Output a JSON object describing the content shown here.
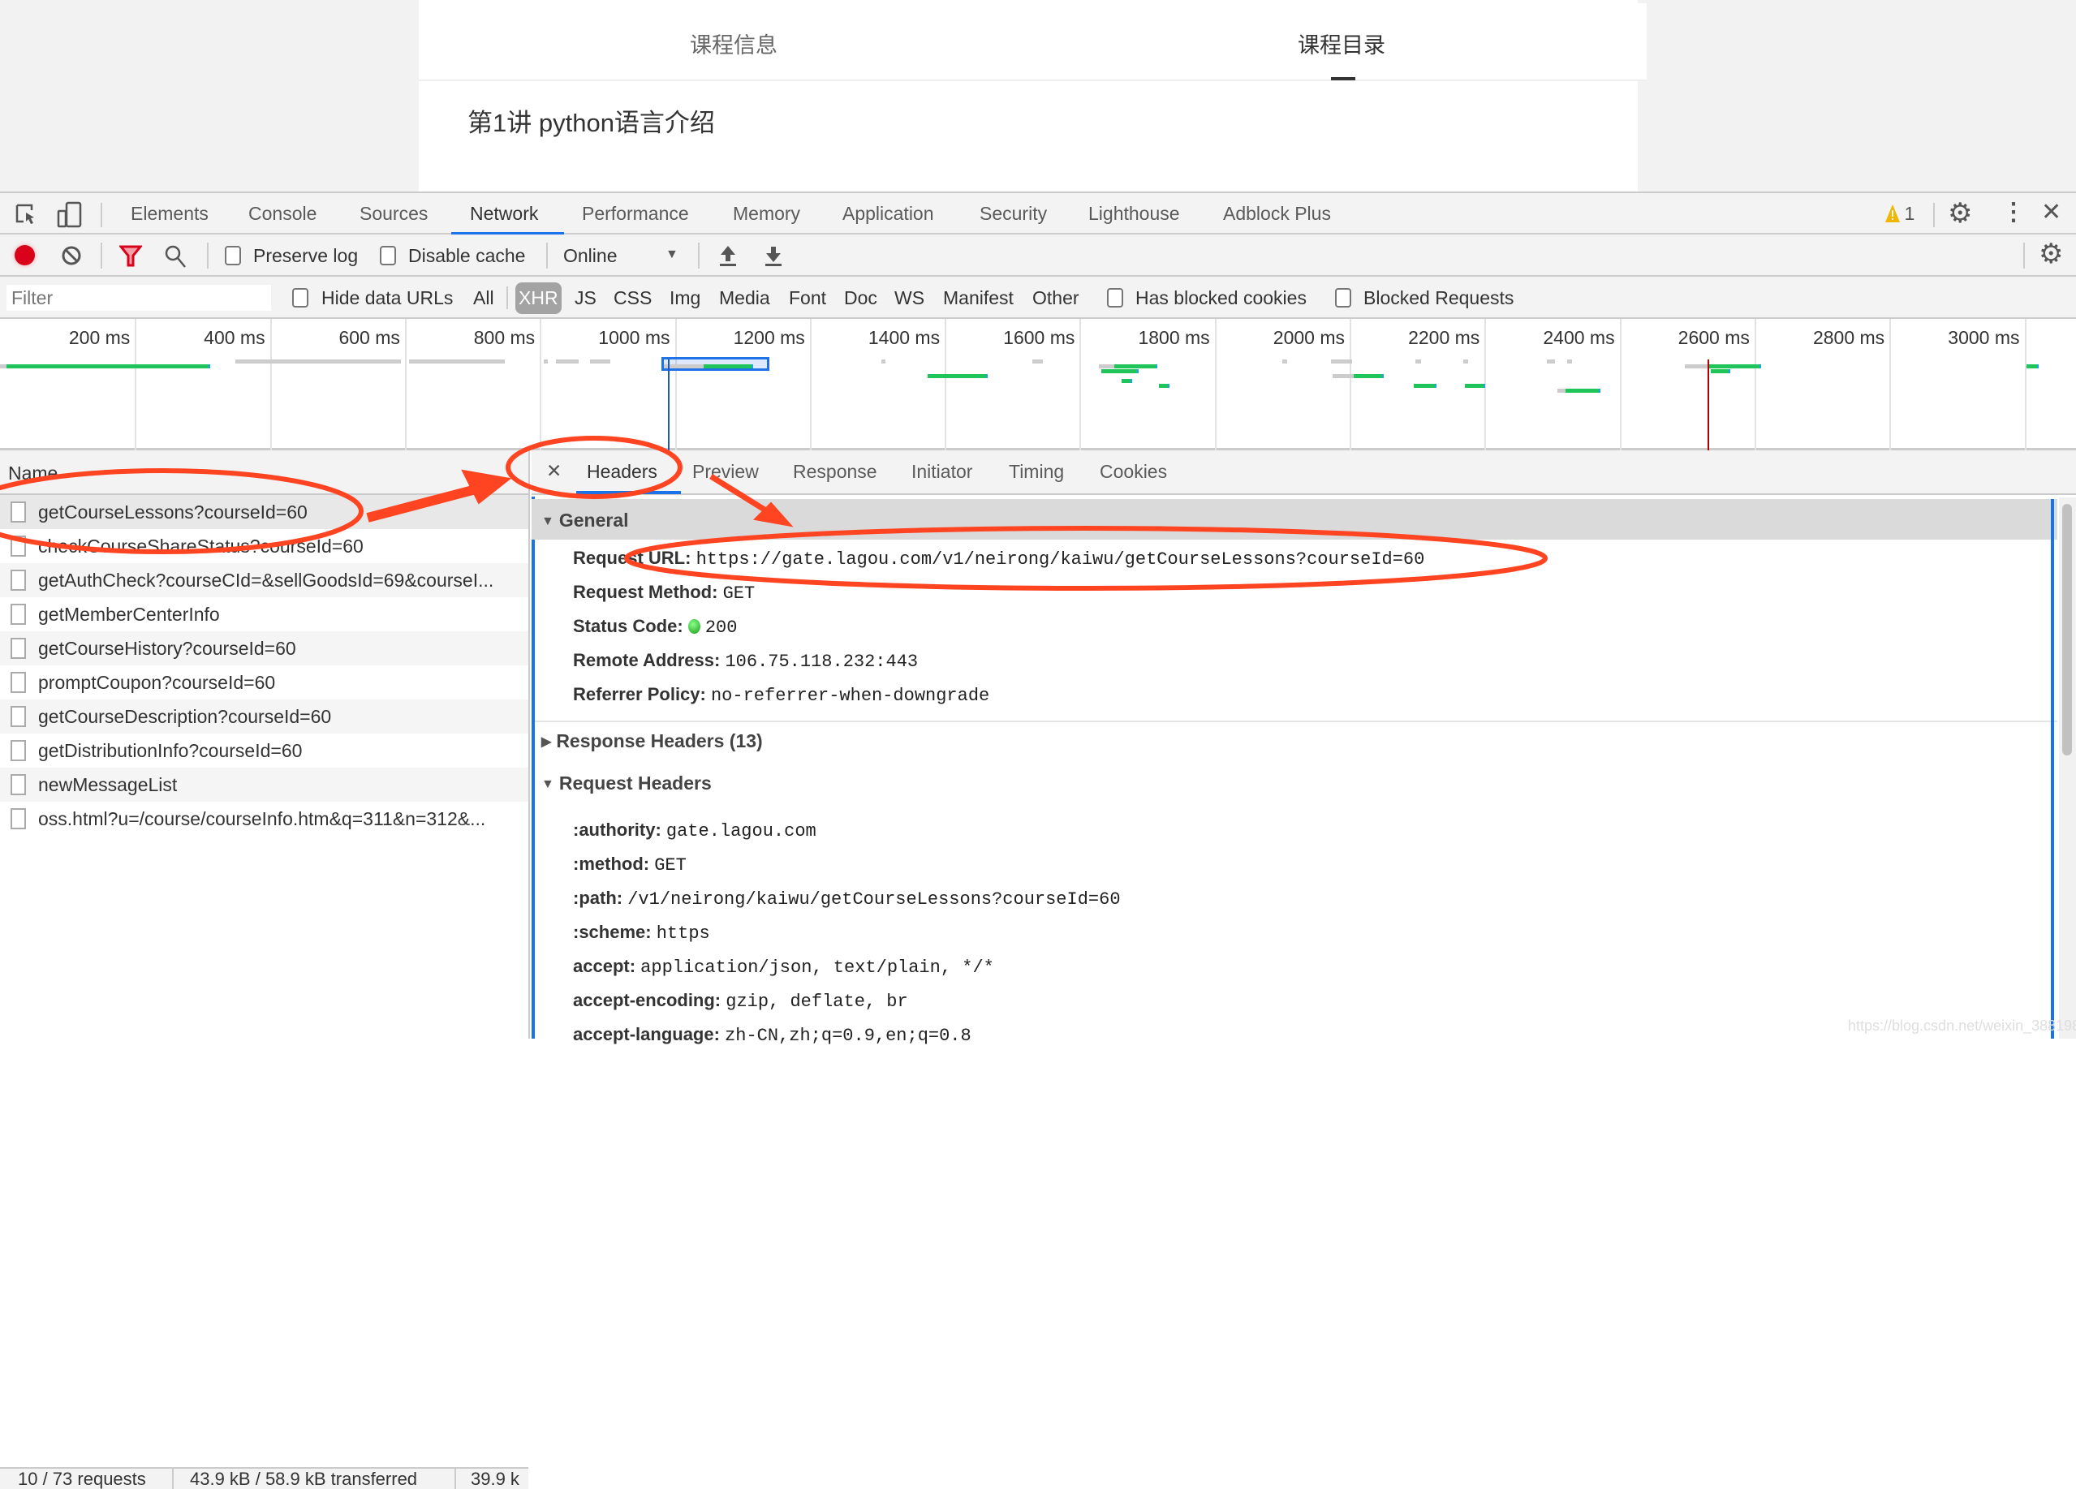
{
  "page": {
    "tabs": [
      {
        "label": "课程信息",
        "active": false
      },
      {
        "label": "课程目录",
        "active": true
      }
    ],
    "lesson_title": "第1讲 python语言介绍"
  },
  "devtools": {
    "tabs": [
      "Elements",
      "Console",
      "Sources",
      "Network",
      "Performance",
      "Memory",
      "Application",
      "Security",
      "Lighthouse",
      "Adblock Plus"
    ],
    "active_tab": "Network",
    "warning_count": "1",
    "accent": "#1a73e8"
  },
  "toolbar": {
    "preserve_log": "Preserve log",
    "disable_cache": "Disable cache",
    "throttle": "Online"
  },
  "filter": {
    "placeholder": "Filter",
    "hide_data_urls": "Hide data URLs",
    "types": [
      "All",
      "XHR",
      "JS",
      "CSS",
      "Img",
      "Media",
      "Font",
      "Doc",
      "WS",
      "Manifest",
      "Other"
    ],
    "active_type": "XHR",
    "has_blocked_cookies": "Has blocked cookies",
    "blocked_requests": "Blocked Requests"
  },
  "timeline": {
    "ticks": [
      "200 ms",
      "400 ms",
      "600 ms",
      "800 ms",
      "1000 ms",
      "1200 ms",
      "1400 ms",
      "1600 ms",
      "1800 ms",
      "2000 ms",
      "2200 ms",
      "2400 ms",
      "2600 ms",
      "2800 ms",
      "3000 ms"
    ],
    "dom_content_loaded_ms": 990,
    "load_ms": 2530,
    "selected": {
      "start": 980,
      "end": 1140
    },
    "bars": [
      {
        "row": 1,
        "start": 0,
        "end": 10,
        "phase": "wait"
      },
      {
        "row": 1,
        "start": 10,
        "end": 312,
        "phase": "download"
      },
      {
        "row": 0,
        "start": 349,
        "end": 594,
        "phase": "wait"
      },
      {
        "row": 0,
        "start": 606,
        "end": 748,
        "phase": "wait"
      },
      {
        "row": 0,
        "start": 806,
        "end": 812,
        "phase": "wait"
      },
      {
        "row": 0,
        "start": 824,
        "end": 858,
        "phase": "wait"
      },
      {
        "row": 0,
        "start": 874,
        "end": 904,
        "phase": "wait"
      },
      {
        "row": 1,
        "start": 984,
        "end": 1043,
        "phase": "wait"
      },
      {
        "row": 1,
        "start": 1043,
        "end": 1116,
        "phase": "download"
      },
      {
        "row": 0,
        "start": 1306,
        "end": 1312,
        "phase": "wait"
      },
      {
        "row": 3,
        "start": 1375,
        "end": 1464,
        "phase": "download"
      },
      {
        "row": 0,
        "start": 1530,
        "end": 1545,
        "phase": "wait"
      },
      {
        "row": 1,
        "start": 1628,
        "end": 1651,
        "phase": "wait"
      },
      {
        "row": 1,
        "start": 1651,
        "end": 1715,
        "phase": "download"
      },
      {
        "row": 2,
        "start": 1632,
        "end": 1687,
        "phase": "download"
      },
      {
        "row": 4,
        "start": 1662,
        "end": 1678,
        "phase": "download"
      },
      {
        "row": 5,
        "start": 1717,
        "end": 1733,
        "phase": "download"
      },
      {
        "row": 0,
        "start": 1900,
        "end": 1908,
        "phase": "wait"
      },
      {
        "row": 0,
        "start": 1972,
        "end": 2004,
        "phase": "wait"
      },
      {
        "row": 3,
        "start": 1975,
        "end": 2006,
        "phase": "wait"
      },
      {
        "row": 3,
        "start": 2006,
        "end": 2051,
        "phase": "download"
      },
      {
        "row": 0,
        "start": 2098,
        "end": 2106,
        "phase": "wait"
      },
      {
        "row": 0,
        "start": 2168,
        "end": 2176,
        "phase": "wait"
      },
      {
        "row": 5,
        "start": 2095,
        "end": 2129,
        "phase": "download"
      },
      {
        "row": 5,
        "start": 2171,
        "end": 2201,
        "phase": "download"
      },
      {
        "row": 0,
        "start": 2292,
        "end": 2304,
        "phase": "wait"
      },
      {
        "row": 0,
        "start": 2322,
        "end": 2330,
        "phase": "wait"
      },
      {
        "row": 6,
        "start": 2308,
        "end": 2320,
        "phase": "wait"
      },
      {
        "row": 6,
        "start": 2320,
        "end": 2372,
        "phase": "download"
      },
      {
        "row": 1,
        "start": 2497,
        "end": 2532,
        "phase": "wait"
      },
      {
        "row": 1,
        "start": 2532,
        "end": 2610,
        "phase": "download"
      },
      {
        "row": 2,
        "start": 2535,
        "end": 2564,
        "phase": "download"
      },
      {
        "row": 1,
        "start": 3003,
        "end": 3021,
        "phase": "download"
      }
    ],
    "colors": {
      "wait": "#cccccc",
      "download": "#1fc55a",
      "end": "#1aa4e8",
      "load": "#b40000",
      "dcl": "#1c57c6"
    }
  },
  "requests": {
    "header": "Name",
    "items": [
      "getCourseLessons?courseId=60",
      "checkCourseShareStatus?courseId=60",
      "getAuthCheck?courseCId=&sellGoodsId=69&courseI...",
      "getMemberCenterInfo",
      "getCourseHistory?courseId=60",
      "promptCoupon?courseId=60",
      "getCourseDescription?courseId=60",
      "getDistributionInfo?courseId=60",
      "newMessageList",
      "oss.html?u=/course/courseInfo.htm&q=311&n=312&..."
    ],
    "selected_index": 0
  },
  "status_bar": {
    "requests": "10 / 73 requests",
    "transferred": "43.9 kB / 58.9 kB transferred",
    "resources": "39.9 k"
  },
  "detail": {
    "tabs": [
      "Headers",
      "Preview",
      "Response",
      "Initiator",
      "Timing",
      "Cookies"
    ],
    "active_tab": "Headers",
    "general_title": "General",
    "general": [
      {
        "key": "Request URL:",
        "value": "https://gate.lagou.com/v1/neirong/kaiwu/getCourseLessons?courseId=60"
      },
      {
        "key": "Request Method:",
        "value": "GET"
      },
      {
        "key": "Status Code:",
        "value": "200"
      },
      {
        "key": "Remote Address:",
        "value": "106.75.118.232:443"
      },
      {
        "key": "Referrer Policy:",
        "value": "no-referrer-when-downgrade"
      }
    ],
    "response_headers_title": "Response Headers (13)",
    "request_headers_title": "Request Headers",
    "request_headers": [
      {
        "key": ":authority:",
        "value": "gate.lagou.com"
      },
      {
        "key": ":method:",
        "value": "GET"
      },
      {
        "key": ":path:",
        "value": "/v1/neirong/kaiwu/getCourseLessons?courseId=60"
      },
      {
        "key": ":scheme:",
        "value": "https"
      },
      {
        "key": "accept:",
        "value": "application/json, text/plain, */*"
      },
      {
        "key": "accept-encoding:",
        "value": "gzip, deflate, br"
      },
      {
        "key": "accept-language:",
        "value": "zh-CN,zh;q=0.9,en;q=0.8"
      }
    ]
  },
  "watermark": "https://blog.csdn.net/weixin_38819889",
  "annotation_color": "#ff4422"
}
